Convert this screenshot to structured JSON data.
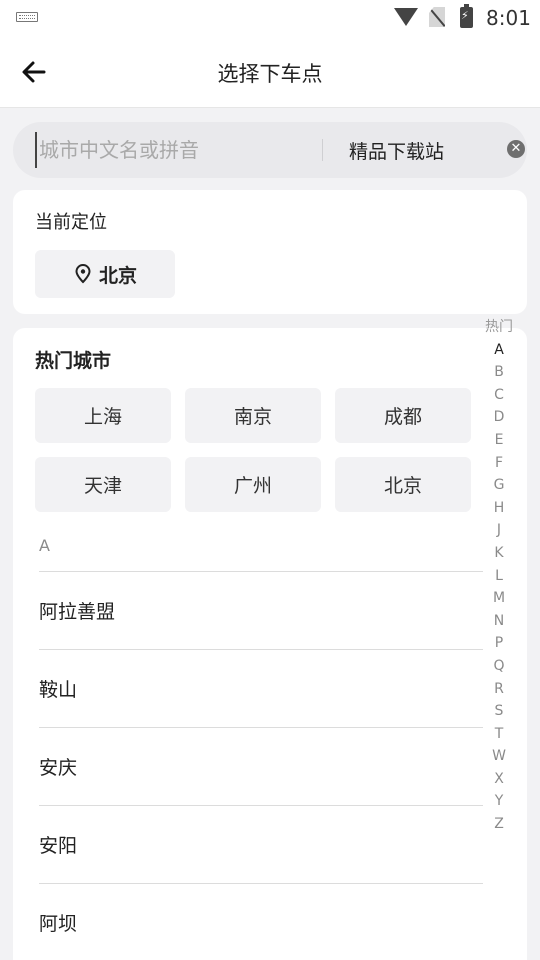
{
  "status_bar": {
    "time": "8:01"
  },
  "header": {
    "title": "选择下车点"
  },
  "search": {
    "placeholder": "城市中文名或拼音",
    "site_label": "精品下载站"
  },
  "current_location": {
    "title": "当前定位",
    "city": "北京"
  },
  "hot_cities": {
    "title": "热门城市",
    "cities": [
      "上海",
      "南京",
      "成都",
      "天津",
      "广州",
      "北京"
    ]
  },
  "section_a": {
    "letter": "A",
    "cities": [
      "阿拉善盟",
      "鞍山",
      "安庆",
      "安阳",
      "阿坝"
    ]
  },
  "index_bar": [
    "热门",
    "A",
    "B",
    "C",
    "D",
    "E",
    "F",
    "G",
    "H",
    "J",
    "K",
    "L",
    "M",
    "N",
    "P",
    "Q",
    "R",
    "S",
    "T",
    "W",
    "X",
    "Y",
    "Z"
  ],
  "icons": {
    "back": "arrow-left-icon",
    "location": "location-pin-icon",
    "clear": "clear-circle-icon"
  }
}
